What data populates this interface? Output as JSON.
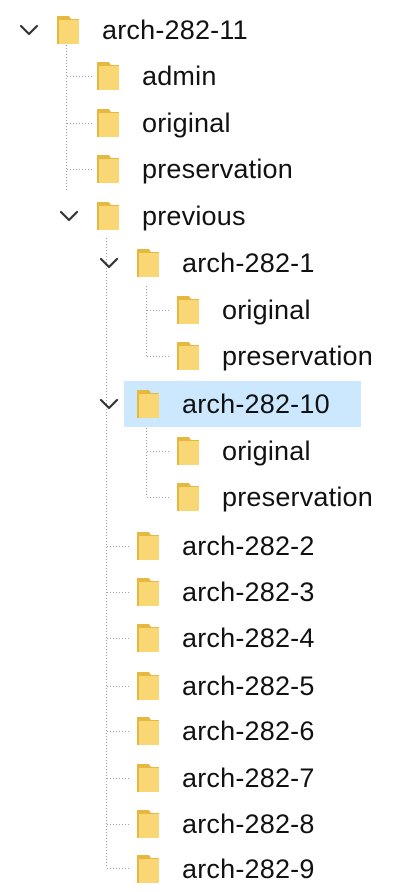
{
  "tree": {
    "nodes": [
      {
        "label": "arch-282-11",
        "expanded": true,
        "selected": false
      },
      {
        "label": "admin",
        "expanded": false,
        "selected": false
      },
      {
        "label": "original",
        "expanded": false,
        "selected": false
      },
      {
        "label": "preservation",
        "expanded": false,
        "selected": false
      },
      {
        "label": "previous",
        "expanded": true,
        "selected": false
      },
      {
        "label": "arch-282-1",
        "expanded": true,
        "selected": false
      },
      {
        "label": "original",
        "expanded": false,
        "selected": false
      },
      {
        "label": "preservation",
        "expanded": false,
        "selected": false
      },
      {
        "label": "arch-282-10",
        "expanded": true,
        "selected": true
      },
      {
        "label": "original",
        "expanded": false,
        "selected": false
      },
      {
        "label": "preservation",
        "expanded": false,
        "selected": false
      },
      {
        "label": "arch-282-2",
        "expanded": false,
        "selected": false
      },
      {
        "label": "arch-282-3",
        "expanded": false,
        "selected": false
      },
      {
        "label": "arch-282-4",
        "expanded": false,
        "selected": false
      },
      {
        "label": "arch-282-5",
        "expanded": false,
        "selected": false
      },
      {
        "label": "arch-282-6",
        "expanded": false,
        "selected": false
      },
      {
        "label": "arch-282-7",
        "expanded": false,
        "selected": false
      },
      {
        "label": "arch-282-8",
        "expanded": false,
        "selected": false
      },
      {
        "label": "arch-282-9",
        "expanded": false,
        "selected": false
      }
    ]
  },
  "colors": {
    "folder_front": "#f8d774",
    "folder_back": "#e7b83f",
    "selection": "#cce8ff",
    "chevron": "#333333",
    "guide": "#a0a0a0",
    "text": "#111111"
  },
  "icons": {
    "folder": "folder-icon",
    "expand": "chevron-down-icon"
  }
}
